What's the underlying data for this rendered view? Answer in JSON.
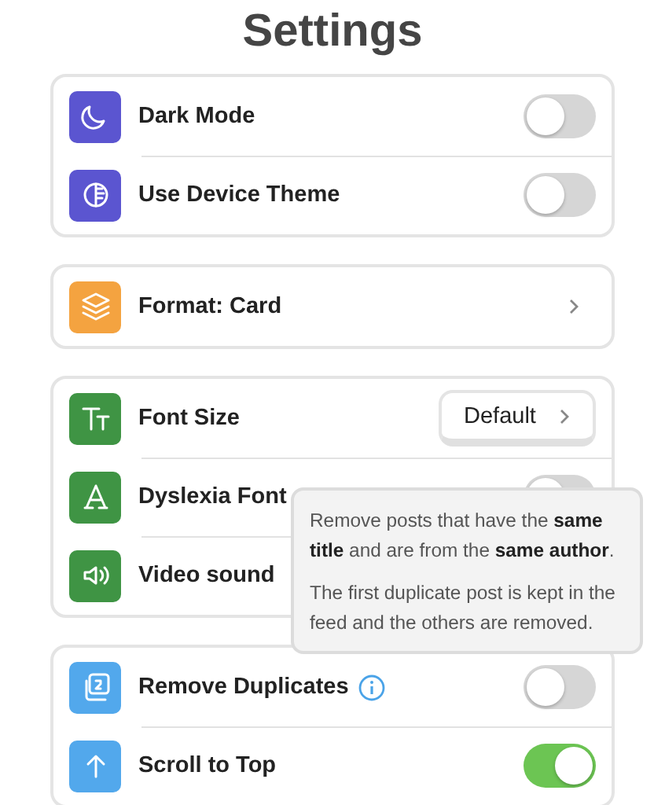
{
  "title": "Settings",
  "groups": [
    {
      "rows": [
        {
          "kind": "toggle",
          "label": "Dark Mode",
          "color": "#5b55d0",
          "on": false
        },
        {
          "kind": "toggle",
          "label": "Use Device Theme",
          "color": "#5b55d0",
          "on": false
        }
      ]
    },
    {
      "rows": [
        {
          "kind": "link",
          "label": "**Format:** Card",
          "color": "#f4a340"
        }
      ]
    },
    {
      "rows": [
        {
          "kind": "select",
          "label": "Font Size",
          "color": "#3f9444",
          "value": "Default"
        },
        {
          "kind": "toggle",
          "label": "Dyslexia Font",
          "color": "#3f9444",
          "on": false
        },
        {
          "kind": "plain",
          "label": "Video sound",
          "color": "#3f9444"
        }
      ]
    },
    {
      "rows": [
        {
          "kind": "toggle",
          "label": "Remove Duplicates",
          "color": "#52a8ec",
          "on": false,
          "info": true
        },
        {
          "kind": "toggle",
          "label": "Scroll to Top",
          "color": "#52a8ec",
          "on": true
        }
      ]
    }
  ],
  "tooltip": {
    "paragraphs": [
      "Remove posts that have the **same title** and are from the **same author**.",
      "The first duplicate post is kept in the feed and the others are removed."
    ]
  }
}
